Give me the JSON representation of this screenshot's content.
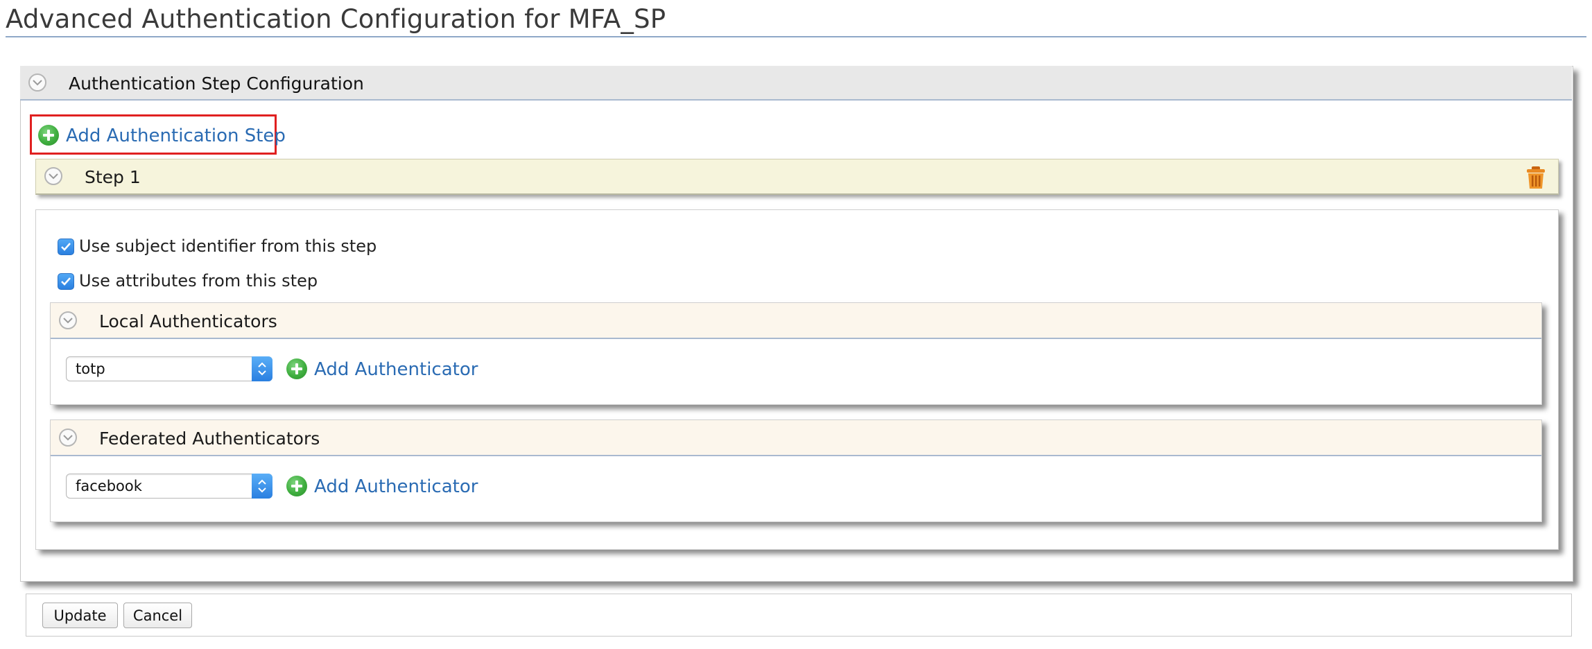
{
  "page": {
    "title": "Advanced Authentication Configuration for MFA_SP"
  },
  "section": {
    "title": "Authentication Step Configuration",
    "add_step_label": "Add Authentication Step"
  },
  "step": {
    "title": "Step 1",
    "checkboxes": [
      {
        "label": "Use subject identifier from this step",
        "checked": true
      },
      {
        "label": "Use attributes from this step",
        "checked": true
      }
    ],
    "local": {
      "title": "Local Authenticators",
      "selected": "totp",
      "add_label": "Add Authenticator"
    },
    "federated": {
      "title": "Federated Authenticators",
      "selected": "facebook",
      "add_label": "Add Authenticator"
    }
  },
  "buttons": {
    "update": "Update",
    "cancel": "Cancel"
  },
  "colors": {
    "link": "#2a6bb3",
    "highlight_border": "#e02020",
    "step_header_bg": "#f6f4dc",
    "auth_header_bg": "#fcf6ec",
    "add_icon": "#3fae3f",
    "trash_icon": "#e07b18"
  }
}
